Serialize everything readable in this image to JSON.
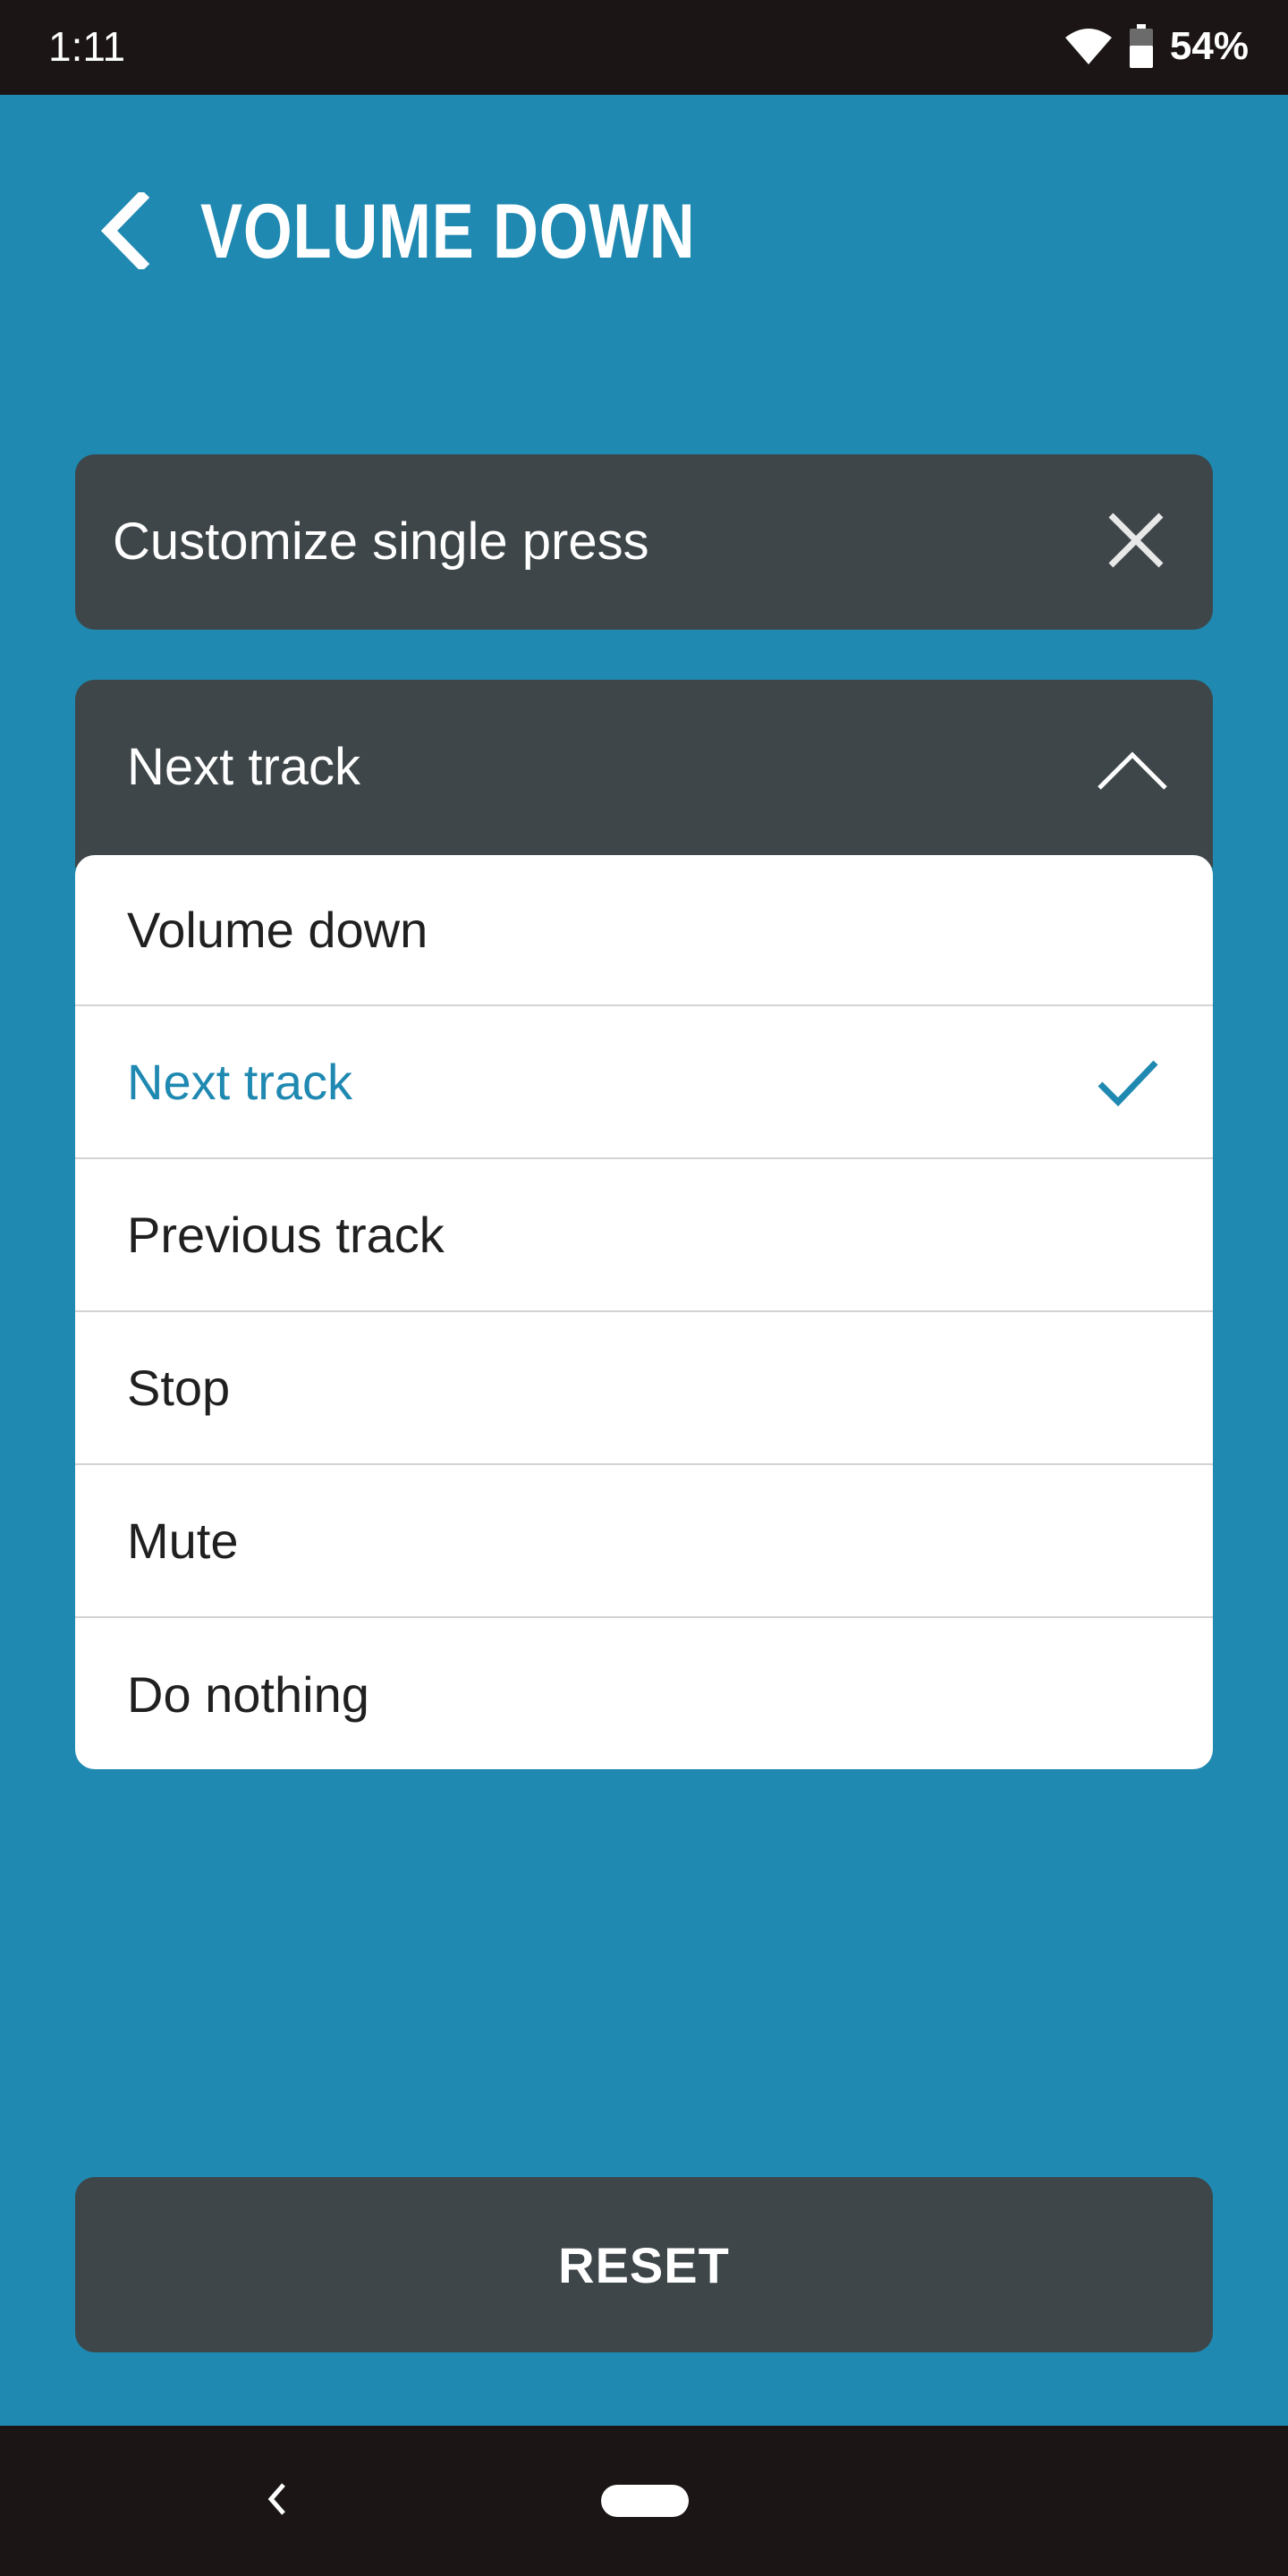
{
  "status_bar": {
    "time": "1:11",
    "battery_percent": "54%",
    "icons": [
      "wifi-icon",
      "battery-icon"
    ]
  },
  "header": {
    "back_icon": "chevron-left-icon",
    "title": "VOLUME DOWN"
  },
  "customize_card": {
    "label": "Customize single press",
    "close_icon": "close-icon"
  },
  "dropdown": {
    "selected_value": "Next track",
    "expanded": true,
    "toggle_icon": "chevron-up-icon",
    "options": [
      {
        "label": "Volume down",
        "selected": false
      },
      {
        "label": "Next track",
        "selected": true
      },
      {
        "label": "Previous track",
        "selected": false
      },
      {
        "label": "Stop",
        "selected": false
      },
      {
        "label": "Mute",
        "selected": false
      },
      {
        "label": "Do nothing",
        "selected": false
      }
    ]
  },
  "reset_button": {
    "label": "RESET"
  },
  "colors": {
    "background": "#1f89b1",
    "card": "#3e4649",
    "accent": "#1f89b1",
    "system_bar": "#1b1615"
  }
}
